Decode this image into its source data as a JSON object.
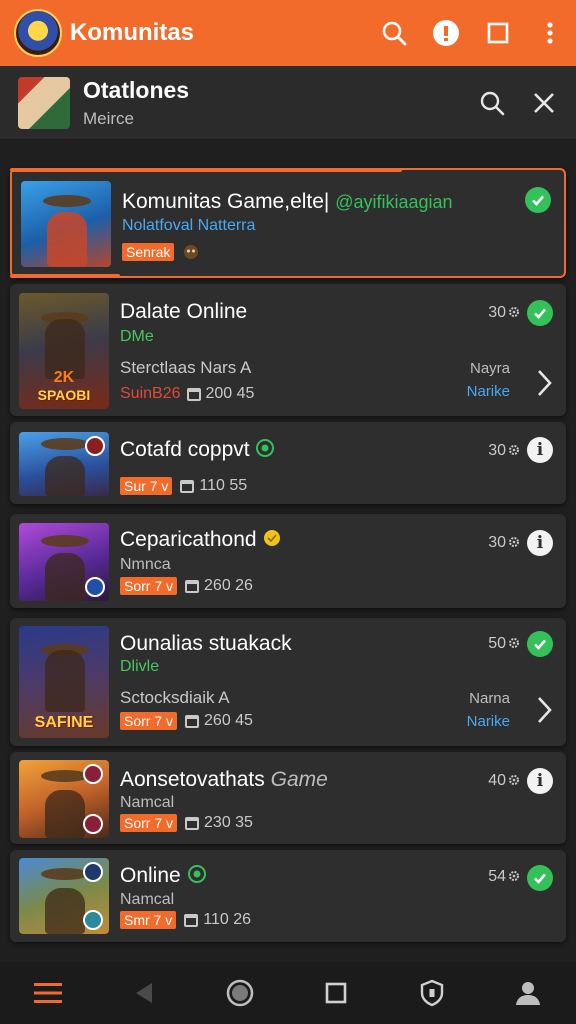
{
  "app": {
    "title": "Komunitas"
  },
  "subheader": {
    "title": "Otatlones",
    "subtitle": "Meirce"
  },
  "cards": [
    {
      "title": "Komunitas Game,elte|",
      "handle": "@ayifikiaagian",
      "line2": "Nolatfoval Natterra",
      "tag": "Senrak",
      "status": "ok"
    },
    {
      "title": "Dalate Online",
      "line2": "DMe",
      "desc": "Sterctlaas Nars A",
      "meta_red": "SuinB26",
      "meta": "200 45",
      "count": "30",
      "status": "ok",
      "side_top": "Nayra",
      "side_bottom": "Narike",
      "thumb_caption_top": "2K",
      "thumb_caption": "SPAOBI"
    },
    {
      "title": "Cotafd coppvt",
      "tag": "Sur 7 v",
      "meta": "110 55",
      "count": "30",
      "status": "info"
    },
    {
      "title": "Ceparicathond",
      "line2": "Nmnca",
      "tag": "Sorr 7 v",
      "meta": "260 26",
      "count": "30",
      "status": "info"
    },
    {
      "title": "Ounalias stuakack",
      "line2": "Dlivle",
      "desc": "Sctocksdiaik A",
      "tag": "Sorr 7 v",
      "meta": "260 45",
      "count": "50",
      "status": "ok",
      "side_top": "Narna",
      "side_bottom": "Narike",
      "thumb_caption": "SAFINE"
    },
    {
      "title": "Aonsetovathats",
      "title_italic": "Game",
      "line2": "Namcal",
      "tag": "Sorr 7 v",
      "meta": "230 35",
      "count": "40",
      "status": "info"
    },
    {
      "title": "Online",
      "line2": "Namcal",
      "tag": "Smr 7 v",
      "meta": "110 26",
      "count": "54",
      "status": "ok"
    }
  ],
  "colors": {
    "accent": "#f26b2b",
    "background": "#1f1f1f",
    "card": "#2e2e2e",
    "success": "#35c15a",
    "link": "#4ba9f2"
  },
  "icons": {
    "appbar": [
      "search-icon",
      "info-icon",
      "square-icon",
      "more-vert-icon"
    ],
    "subheader": [
      "search-icon",
      "close-icon"
    ],
    "navbar": [
      "menu-icon",
      "back-icon",
      "home-icon",
      "recents-icon",
      "shield-icon",
      "profile-icon"
    ]
  }
}
